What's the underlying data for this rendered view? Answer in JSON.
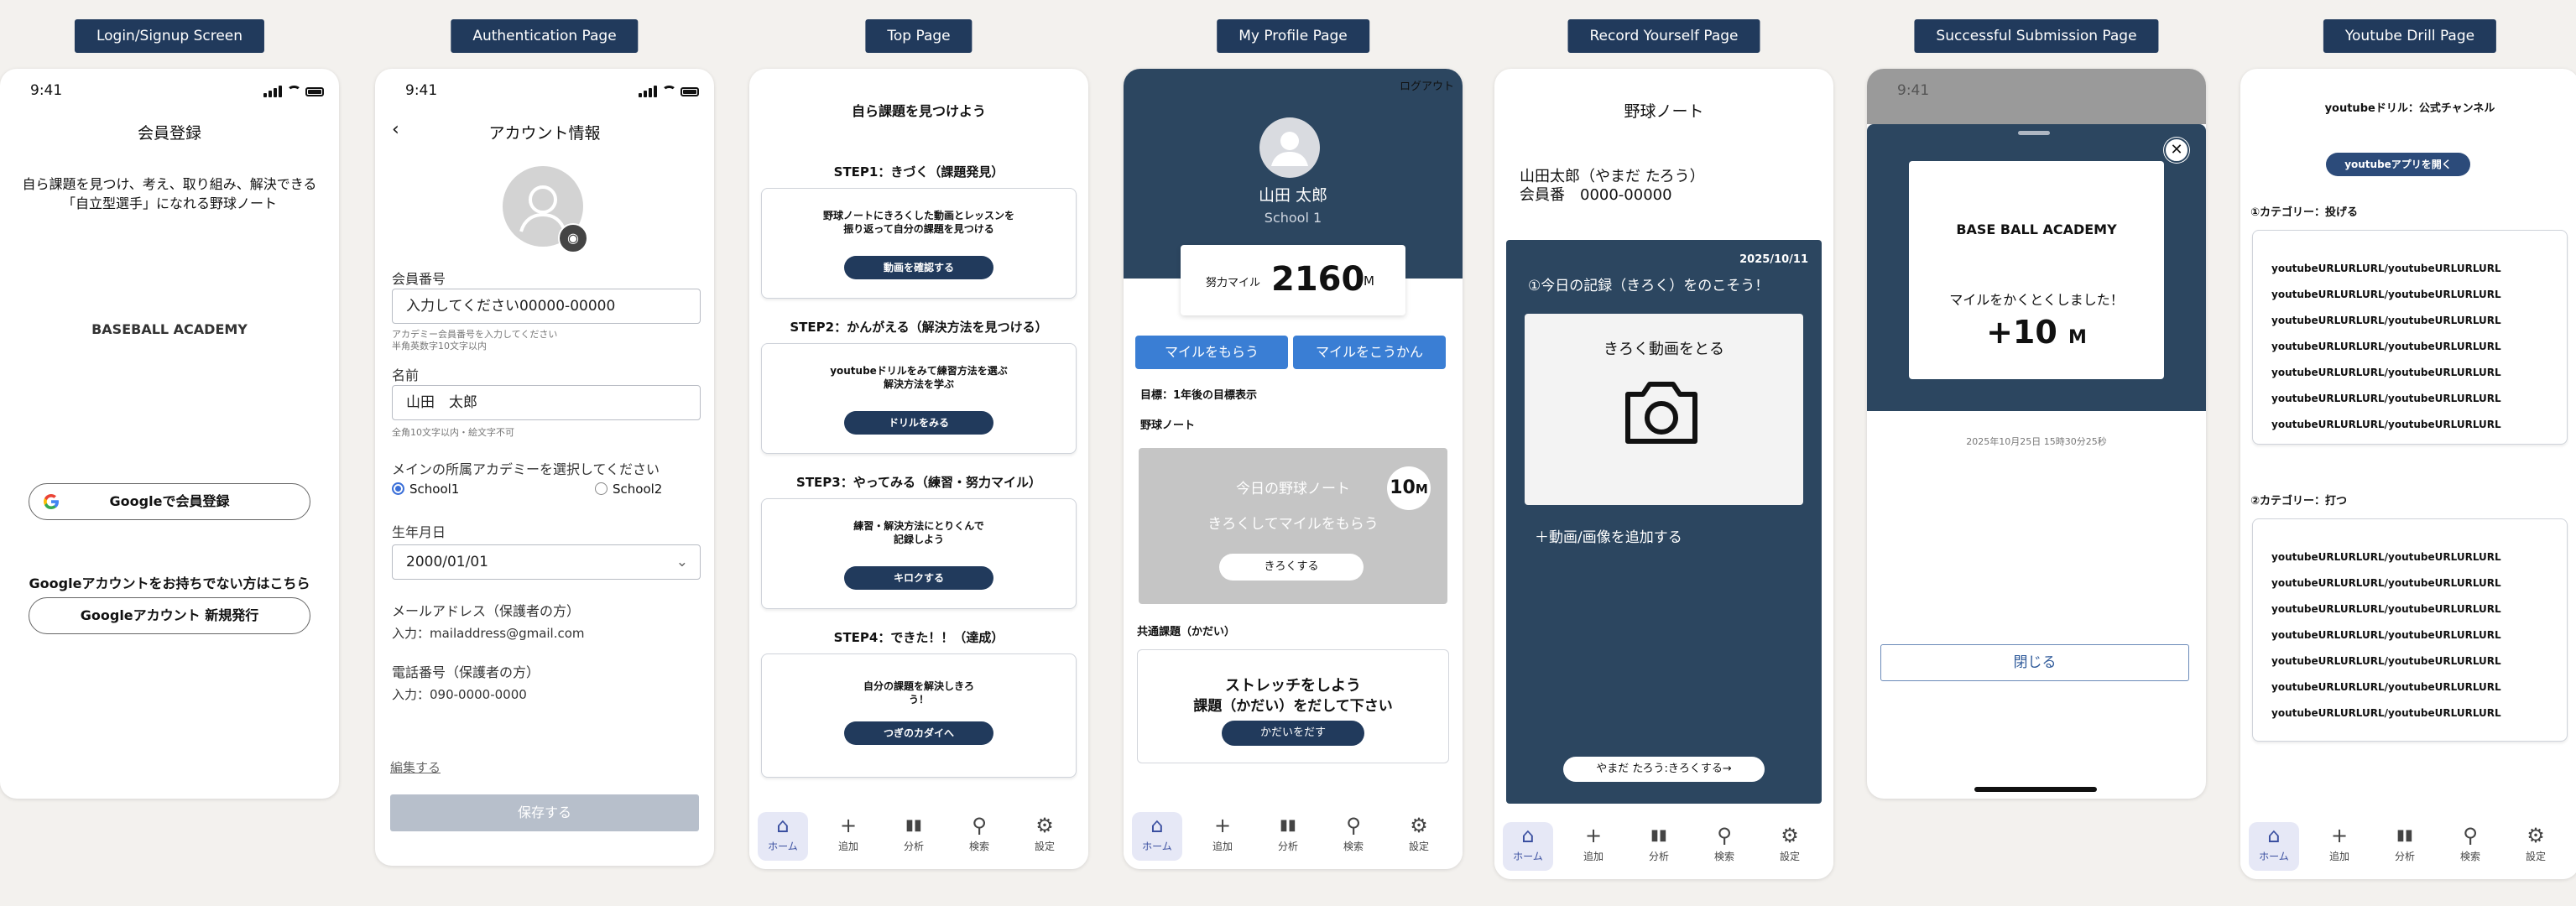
{
  "pills": [
    "Login/Signup Screen",
    "Authentication Page",
    "Top Page",
    "My Profile Page",
    "Record Yourself Page",
    "Successful Submission Page",
    "Youtube Drill Page"
  ],
  "time": "9:41",
  "s1": {
    "title": "会員登録",
    "desc": "自ら課題を見つけ、考え、取り組み、解決できる\n「自立型選手」になれる野球ノート",
    "brand": "BASEBALL ACADEMY",
    "google_btn": "Googleで会員登録",
    "no_account": "Googleアカウントをお持ちでない方はこちら",
    "new_btn": "Googleアカウント 新規発行"
  },
  "s2": {
    "title": "アカウント情報",
    "member_label": "会員番号",
    "member_value": "入力してください00000-00000",
    "member_hint": "アカデミー会員番号を入力してください\n半角英数字10文字以内",
    "name_label": "名前",
    "name_value": "山田　太郎",
    "name_hint": "全角10文字以内・絵文字不可",
    "academy_label": "メインの所属アカデミーを選択してください",
    "school1": "School1",
    "school2": "School2",
    "dob_label": "生年月日",
    "dob_value": "2000/01/01",
    "email_label": "メールアドレス（保護者の方）",
    "email_value": "入力：mailaddress@gmail.com",
    "phone_label": "電話番号（保護者の方）",
    "phone_value": "入力：090-0000-0000",
    "edit_link": "編集する",
    "save_btn": "保存する"
  },
  "s3": {
    "title": "自ら課題を見つけよう",
    "steps": [
      {
        "head": "STEP1：きづく（課題発見）",
        "body": "野球ノートにきろくした動画とレッスンを\n振り返って自分の課題を見つける",
        "btn": "動画を確認する"
      },
      {
        "head": "STEP2：かんがえる（解決方法を見つける）",
        "body": "youtubeドリルをみて練習方法を選ぶ\n解決方法を学ぶ",
        "btn": "ドリルをみる"
      },
      {
        "head": "STEP3：やってみる（練習・努力マイル）",
        "body": "練習・解決方法にとりくんで\n記録しよう",
        "btn": "キロクする"
      },
      {
        "head": "STEP4：できた！！（達成）",
        "body": "自分の課題を解決しきろ\nう！",
        "btn": "つぎのカダイへ"
      }
    ]
  },
  "nav": {
    "home": "ホーム",
    "add": "追加",
    "analytics": "分析",
    "search": "検索",
    "settings": "設定"
  },
  "s4": {
    "logout": "ログアウト",
    "name": "山田 太郎",
    "school": "School 1",
    "mile_label": "努力マイル",
    "mile_value": "2160",
    "mile_unit": "M",
    "get_btn": "マイルをもらう",
    "exchange_btn": "マイルをこうかん",
    "goal": "目標：1年後の目標表示",
    "note": "野球ノート",
    "today_line1": "今日の野球ノート",
    "today_line2": "きろくしてマイルをもらう",
    "badge": "10",
    "badge_unit": "M",
    "record_btn": "きろくする",
    "common": "共通課題（かだい）",
    "stretch1": "ストレッチをしよう",
    "stretch2": "課題（かだい）をだして下さい",
    "submit_btn": "かだいをだす"
  },
  "s5": {
    "title": "野球ノート",
    "name": "山田太郎（やまだ たろう）",
    "member": "会員番　0000-00000",
    "date": "2025/10/11",
    "heading": "①今日の記録（きろく）をのこそう！",
    "video_label": "きろく動画をとる",
    "add": "＋動画/画像を追加する",
    "footer_btn": "やまだ たろう:きろくする→"
  },
  "s6": {
    "brand": "BASE BALL ACADEMY",
    "msg": "マイルをかくとくしました！",
    "value": "+10",
    "unit": "M",
    "timestamp": "2025年10月25日 15時30分25秒",
    "close_btn": "閉じる"
  },
  "s7": {
    "title": "youtubeドリル：公式チャンネル",
    "open_btn": "youtubeアプリを開く",
    "cat1": "①カテゴリー：投げる",
    "cat2": "②カテゴリー：打つ",
    "url": "youtubeURLURLURL/youtubeURLURLURL",
    "rows1": [
      1,
      2,
      3,
      4,
      5,
      6,
      7
    ],
    "rows2": [
      1,
      2,
      3,
      4,
      5,
      6,
      7
    ]
  }
}
